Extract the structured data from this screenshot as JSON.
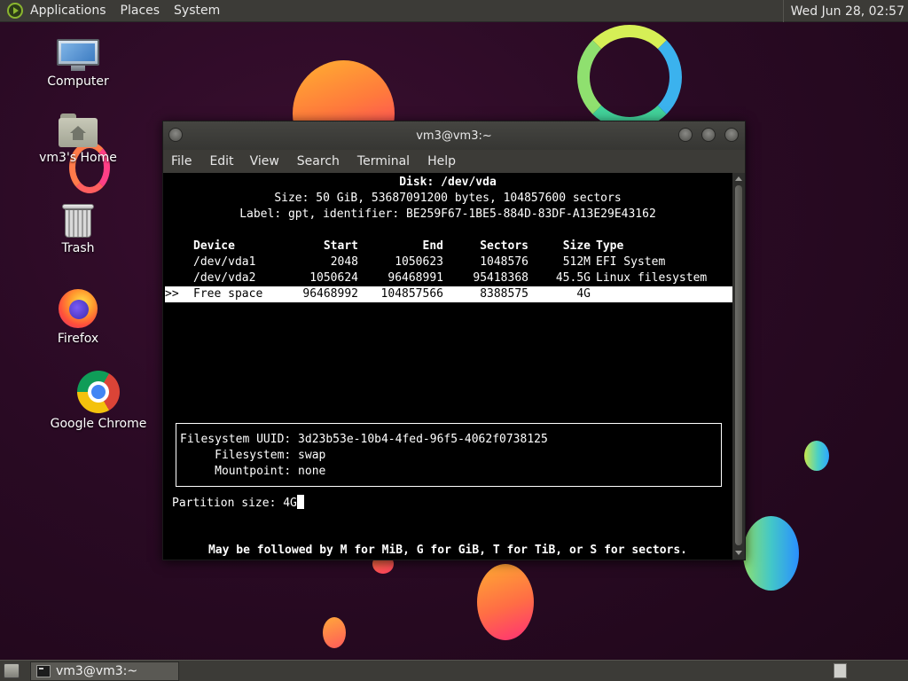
{
  "top_panel": {
    "menus": [
      "Applications",
      "Places",
      "System"
    ],
    "clock": "Wed Jun 28, 02:57"
  },
  "desktop": {
    "icons": [
      {
        "label": "Computer",
        "icon": "computer-icon"
      },
      {
        "label": "vm3's Home",
        "icon": "home-folder-icon"
      },
      {
        "label": "Trash",
        "icon": "trash-icon"
      },
      {
        "label": "Firefox",
        "icon": "firefox-icon"
      },
      {
        "label": "Google Chrome",
        "icon": "chrome-icon"
      }
    ]
  },
  "window": {
    "title": "vm3@vm3:~",
    "menus": [
      "File",
      "Edit",
      "View",
      "Search",
      "Terminal",
      "Help"
    ]
  },
  "cfdisk": {
    "header": {
      "disk": "Disk: /dev/vda",
      "size": "Size: 50 GiB, 53687091200 bytes, 104857600 sectors",
      "label": "Label: gpt, identifier: BE259F67-1BE5-884D-83DF-A13E29E43162"
    },
    "columns": {
      "device": "Device",
      "start": "Start",
      "end": "End",
      "sectors": "Sectors",
      "size": "Size",
      "type": "Type"
    },
    "rows": [
      {
        "marker": "",
        "device": "/dev/vda1",
        "start": "2048",
        "end": "1050623",
        "sectors": "1048576",
        "size": "512M",
        "type": "EFI System"
      },
      {
        "marker": "",
        "device": "/dev/vda2",
        "start": "1050624",
        "end": "96468991",
        "sectors": "95418368",
        "size": "45.5G",
        "type": "Linux filesystem"
      },
      {
        "marker": ">>",
        "device": "Free space",
        "start": "96468992",
        "end": "104857566",
        "sectors": "8388575",
        "size": "4G",
        "type": ""
      }
    ],
    "info": {
      "uuid": "Filesystem UUID: 3d23b53e-10b4-4fed-96f5-4062f0738125",
      "fs": "     Filesystem: swap",
      "mount": "     Mountpoint: none"
    },
    "prompt_label": "Partition size: ",
    "prompt_value": "4G",
    "hint": "May be followed by M for MiB, G for GiB, T for TiB, or S for sectors."
  },
  "bottom_panel": {
    "task_label": "vm3@vm3:~"
  },
  "colors": {
    "panel": "#3c3b37",
    "terminal_bg": "#000000",
    "terminal_fg": "#ffffff",
    "wallpaper": "#2a0a24"
  }
}
